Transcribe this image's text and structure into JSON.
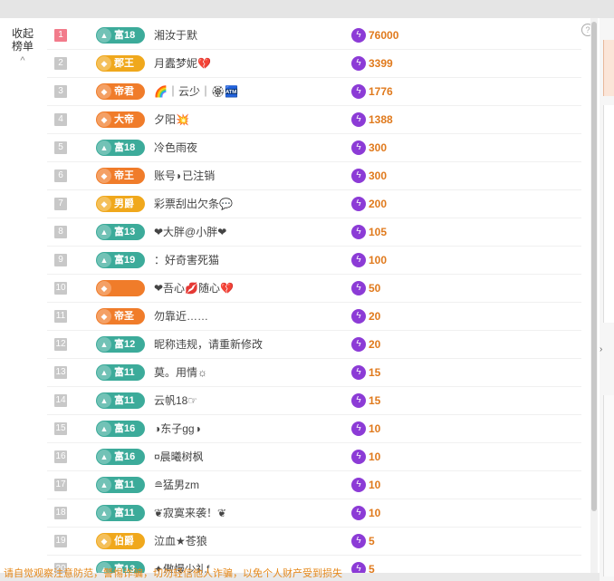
{
  "collapse": {
    "line1": "收起",
    "line2": "榜单",
    "chevron": "^"
  },
  "help_icon": "?",
  "bottom_text": "请自觉观察注意防范，警惕诈骗，切勿轻信他人诈骗，以免个人财产受到损失",
  "colors": {
    "teal": "#3cab9a",
    "gold": "#f0a81c",
    "orange": "#f07c2a",
    "value": "#e07a1d",
    "bolt": "#8c3bd6"
  },
  "rows": [
    {
      "rank": "1",
      "badge": "富18",
      "badge_type": "teal",
      "name": "湘汝于默",
      "value": "76000"
    },
    {
      "rank": "2",
      "badge": "郡王",
      "badge_type": "gold",
      "name": "月蠹梦妮💔",
      "value": "3399"
    },
    {
      "rank": "3",
      "badge": "帝君",
      "badge_type": "orange",
      "name": "🌈｜云少｜🏵🏧",
      "value": "1776"
    },
    {
      "rank": "4",
      "badge": "大帝",
      "badge_type": "orange",
      "name": "夕阳💥",
      "value": "1388"
    },
    {
      "rank": "5",
      "badge": "富18",
      "badge_type": "teal",
      "name": "冷色雨夜",
      "value": "300"
    },
    {
      "rank": "6",
      "badge": "帝王",
      "badge_type": "orange",
      "name": "账号◗已注销",
      "value": "300"
    },
    {
      "rank": "7",
      "badge": "男爵",
      "badge_type": "gold",
      "name": "彩票刮出欠条💬",
      "value": "200"
    },
    {
      "rank": "8",
      "badge": "富13",
      "badge_type": "teal",
      "name": "❤大胖@小胖❤",
      "value": "105"
    },
    {
      "rank": "9",
      "badge": "富19",
      "badge_type": "teal",
      "name": "：好奇害死猫",
      "value": "100"
    },
    {
      "rank": "10",
      "badge": "",
      "badge_type": "orange",
      "name": "❤吾心💋随心💔",
      "value": "50"
    },
    {
      "rank": "11",
      "badge": "帝圣",
      "badge_type": "orange",
      "name": "勿靠近……",
      "value": "20"
    },
    {
      "rank": "12",
      "badge": "富12",
      "badge_type": "teal",
      "name": "昵称违规，请重新修改",
      "value": "20"
    },
    {
      "rank": "13",
      "badge": "富11",
      "badge_type": "teal",
      "name": "莫。用情☼",
      "value": "15"
    },
    {
      "rank": "14",
      "badge": "富11",
      "badge_type": "teal",
      "name": "云帆18☞",
      "value": "15"
    },
    {
      "rank": "15",
      "badge": "富16",
      "badge_type": "teal",
      "name": "◑东子gg◑",
      "value": "10"
    },
    {
      "rank": "16",
      "badge": "富16",
      "badge_type": "teal",
      "name": "¤晨曦树枫",
      "value": "10"
    },
    {
      "rank": "17",
      "badge": "富11",
      "badge_type": "teal",
      "name": "≘猛男zm",
      "value": "10"
    },
    {
      "rank": "18",
      "badge": "富11",
      "badge_type": "teal",
      "name": "❦寂寞来袭！❦",
      "value": "10"
    },
    {
      "rank": "19",
      "badge": "伯爵",
      "badge_type": "gold",
      "name": "泣血★苍狼",
      "value": "5"
    },
    {
      "rank": "20",
      "badge": "富13",
      "badge_type": "teal",
      "name": "✦傲慢少礼f",
      "value": "5"
    }
  ]
}
